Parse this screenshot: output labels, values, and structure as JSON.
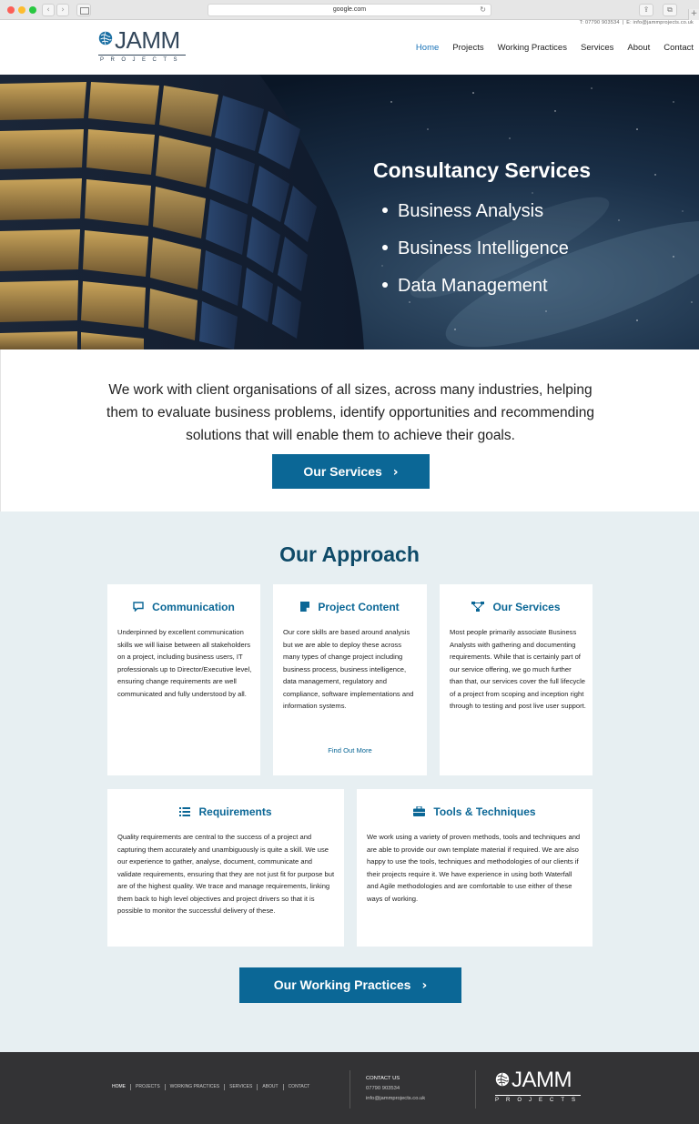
{
  "browser": {
    "url": "google.com",
    "back_icon": "‹",
    "forward_icon": "›",
    "reload_icon": "↻",
    "share_icon": "⇪",
    "tabs_icon": "⧉",
    "new_tab_icon": "+"
  },
  "header": {
    "phone": "T: 07790 903534",
    "separator": "|",
    "email": "E: info@jammprojects.co.uk",
    "logo": {
      "word": "JAMM",
      "sub": "PROJECTS"
    },
    "nav": [
      {
        "label": "Home",
        "active": true
      },
      {
        "label": "Projects"
      },
      {
        "label": "Working Practices"
      },
      {
        "label": "Services"
      },
      {
        "label": "About"
      },
      {
        "label": "Contact"
      }
    ]
  },
  "hero": {
    "title": "Consultancy Services",
    "items": [
      "Business Analysis",
      "Business Intelligence",
      "Data Management"
    ]
  },
  "intro": {
    "text": "We work with client organisations of all sizes, across many industries, helping them to evaluate business problems, identify opportunities and recommending solutions that will enable them to achieve their goals.",
    "button_label": "Our Services",
    "chevron": "›"
  },
  "approach": {
    "title": "Our Approach",
    "cards": [
      {
        "title": "Communication",
        "icon": "speech-bubble-icon",
        "body": "Underpinned by excellent communication skills we will liaise between all stakeholders on a project, including business users, IT professionals up to Director/Executive level, ensuring change requirements are well communicated and fully understood by all."
      },
      {
        "title": "Project Content",
        "icon": "note-icon",
        "body": "Our core skills are based around analysis but we are able to deploy these across many types of change project including business process, business intelligence, data management, regulatory and compliance, software implementations and information systems.",
        "link": "Find Out More"
      },
      {
        "title": "Our Services",
        "icon": "sitemap-icon",
        "body": "Most people primarily associate Business Analysts with gathering and documenting requirements. While that is certainly part of our service offering, we go much further than that, our services cover the full lifecycle of a project from scoping and inception right through to testing and post live user support."
      },
      {
        "title": "Requirements",
        "icon": "list-icon",
        "body": "Quality requirements are central to the success of a project and capturing them accurately and unambiguously is quite a skill. We use our experience to gather, analyse, document, communicate and validate requirements, ensuring that they are not just fit for purpose but are of the highest quality. We trace and manage requirements, linking them back to high level objectives and project drivers so that it is possible to monitor the successful delivery of these."
      },
      {
        "title": "Tools & Techniques",
        "icon": "briefcase-icon",
        "body": "We work using a variety of proven methods, tools and techniques and are able to provide our own template material if required. We are also happy to use the tools, techniques and methodologies of our clients if their projects require it.  We have experience in using both Waterfall and Agile methodologies and are comfortable to use either of these ways of working."
      }
    ],
    "button_label": "Our Working Practices",
    "chevron": "›"
  },
  "footer": {
    "nav": [
      "HOME",
      "PROJECTS",
      "WORKING PRACTICES",
      "SERVICES",
      "ABOUT",
      "CONTACT"
    ],
    "contact_title": "CONTACT US",
    "phone": "07790 903534",
    "email": "info@jammprojects.co.uk",
    "logo": {
      "word": "JAMM",
      "sub": "PROJECTS"
    }
  },
  "colors": {
    "brand_blue": "#0b6796",
    "title_blue": "#0e4a68",
    "nav_active": "#1a73b8",
    "footer_bg": "#333335",
    "approach_bg": "#e7eff2"
  }
}
